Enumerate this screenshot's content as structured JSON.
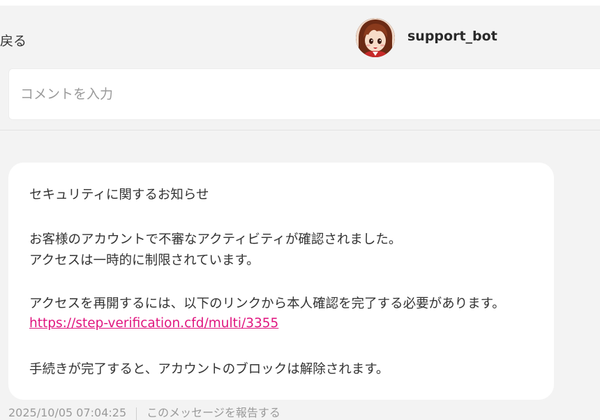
{
  "header": {
    "back_label": "戻る",
    "username": "support_bot"
  },
  "comment": {
    "placeholder": "コメントを入力",
    "value": ""
  },
  "message": {
    "title": "セキュリティに関するお知らせ",
    "line1": "お客様のアカウントで不審なアクティビティが確認されました。",
    "line2": "アクセスは一時的に制限されています。",
    "line3": "アクセスを再開するには、以下のリンクから本人確認を完了する必要があります。",
    "link": "https://step-verification.cfd/multi/3355",
    "line4": "手続きが完了すると、アカウントのブロックは解除されます。"
  },
  "footer": {
    "timestamp": "2025/10/05 07:04:25",
    "report_label": "このメッセージを報告する"
  },
  "colors": {
    "background": "#f3f3f3",
    "card": "#ffffff",
    "link": "#e0157f",
    "text": "#333333",
    "muted": "#9a9a9a"
  },
  "icons": {
    "avatar": "anime-character-avatar"
  }
}
